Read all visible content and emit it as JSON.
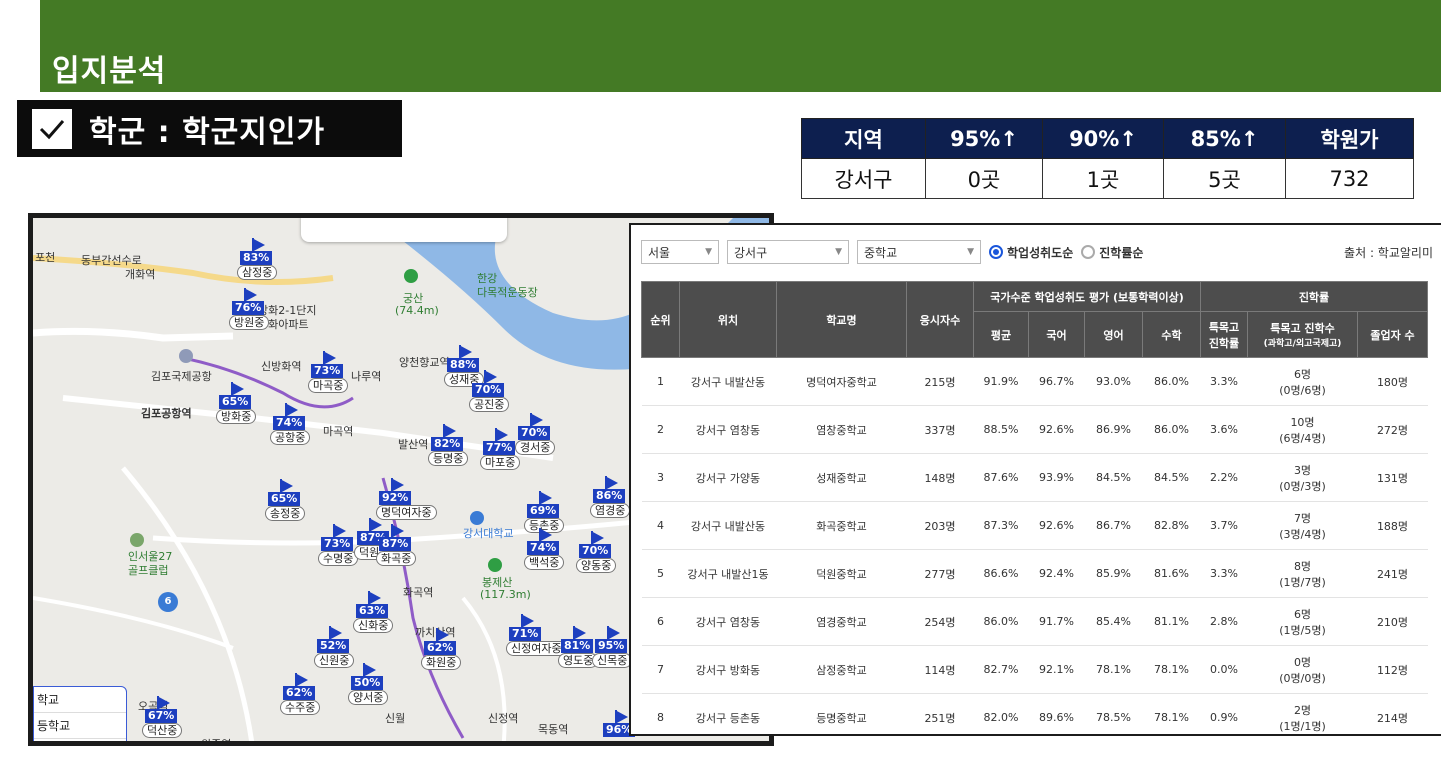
{
  "header": {
    "title": "입지분석"
  },
  "section": {
    "label": "학군 : 학군지인가"
  },
  "summary": {
    "headers": [
      "지역",
      "95%↑",
      "90%↑",
      "85%↑",
      "학원가"
    ],
    "values": [
      "강서구",
      "0곳",
      "1곳",
      "5곳",
      "732"
    ]
  },
  "map": {
    "labels": [
      "포천",
      "동부간선수로",
      "개화역",
      "방화2-1단지",
      "방화아파트",
      "궁산",
      "(74.4m)",
      "한강",
      "다목적운동장",
      "김포국제공항",
      "김포공항역",
      "신방화역",
      "양천향교역",
      "나루역",
      "마곡역",
      "발산역",
      "인서울27",
      "골프클럽",
      "강서대학교",
      "봉제산",
      "(117.3m)",
      "화곡역",
      "까치산역",
      "신월",
      "목동역",
      "원종역",
      "오곡역",
      "신정역"
    ],
    "pins": [
      {
        "pct": "83%",
        "name": "삼정중"
      },
      {
        "pct": "76%",
        "name": "방원중"
      },
      {
        "pct": "65%",
        "name": "방화중"
      },
      {
        "pct": "73%",
        "name": "마곡중"
      },
      {
        "pct": "74%",
        "name": "공항중"
      },
      {
        "pct": "88%",
        "name": "성재중"
      },
      {
        "pct": "70%",
        "name": "공진중"
      },
      {
        "pct": "82%",
        "name": "등명중"
      },
      {
        "pct": "77%",
        "name": "마포중"
      },
      {
        "pct": "70%",
        "name": "경서중"
      },
      {
        "pct": "65%",
        "name": "송정중"
      },
      {
        "pct": "92%",
        "name": "명덕여자중"
      },
      {
        "pct": "73%",
        "name": "수명중"
      },
      {
        "pct": "87%",
        "name": "덕원중"
      },
      {
        "pct": "87%",
        "name": "화곡중"
      },
      {
        "pct": "69%",
        "name": "등촌중"
      },
      {
        "pct": "74%",
        "name": "백석중"
      },
      {
        "pct": "86%",
        "name": "염경중"
      },
      {
        "pct": "70%",
        "name": "양동중"
      },
      {
        "pct": "63%",
        "name": "신화중"
      },
      {
        "pct": "52%",
        "name": "신원중"
      },
      {
        "pct": "62%",
        "name": "화원중"
      },
      {
        "pct": "71%",
        "name": "신정여자중"
      },
      {
        "pct": "81%",
        "name": "영도중"
      },
      {
        "pct": "95%",
        "name": "신목중"
      },
      {
        "pct": "50%",
        "name": "양서중"
      },
      {
        "pct": "62%",
        "name": "수주중"
      },
      {
        "pct": "67%",
        "name": "덕산중"
      },
      {
        "pct": "96%",
        "name": ""
      }
    ],
    "tabs": [
      "학교",
      "등학교"
    ],
    "route_badge": "6"
  },
  "table": {
    "filters": {
      "city": "서울",
      "district": "강서구",
      "level": "중학교",
      "radio_on": "학업성취도순",
      "radio_off": "진학률순",
      "source": "출처 : 학교알리미"
    },
    "head": {
      "rank": "순위",
      "location": "위치",
      "school": "학교명",
      "applicants": "응시자수",
      "group_national": "국가수준 학업성취도 평가 (보통학력이상)",
      "avg": "평균",
      "kor": "국어",
      "eng": "영어",
      "math": "수학",
      "group_adv": "진학률",
      "sp_rate": "특목고 진학률",
      "sp_count": "특목고 진학수",
      "sp_count_sub": "(과학고/외고국제고)",
      "graduates": "졸업자 수"
    },
    "rows": [
      {
        "rank": "1",
        "loc": "강서구 내발산동",
        "school": "명덕여자중학교",
        "app": "215명",
        "avg": "91.9%",
        "kor": "96.7%",
        "eng": "93.0%",
        "math": "86.0%",
        "sp": "3.3%",
        "cnt": "6명",
        "cnt_sub": "(0명/6명)",
        "grad": "180명"
      },
      {
        "rank": "2",
        "loc": "강서구 염창동",
        "school": "염창중학교",
        "app": "337명",
        "avg": "88.5%",
        "kor": "92.6%",
        "eng": "86.9%",
        "math": "86.0%",
        "sp": "3.6%",
        "cnt": "10명",
        "cnt_sub": "(6명/4명)",
        "grad": "272명"
      },
      {
        "rank": "3",
        "loc": "강서구 가양동",
        "school": "성재중학교",
        "app": "148명",
        "avg": "87.6%",
        "kor": "93.9%",
        "eng": "84.5%",
        "math": "84.5%",
        "sp": "2.2%",
        "cnt": "3명",
        "cnt_sub": "(0명/3명)",
        "grad": "131명"
      },
      {
        "rank": "4",
        "loc": "강서구 내발산동",
        "school": "화곡중학교",
        "app": "203명",
        "avg": "87.3%",
        "kor": "92.6%",
        "eng": "86.7%",
        "math": "82.8%",
        "sp": "3.7%",
        "cnt": "7명",
        "cnt_sub": "(3명/4명)",
        "grad": "188명"
      },
      {
        "rank": "5",
        "loc": "강서구 내발산1동",
        "school": "덕원중학교",
        "app": "277명",
        "avg": "86.6%",
        "kor": "92.4%",
        "eng": "85.9%",
        "math": "81.6%",
        "sp": "3.3%",
        "cnt": "8명",
        "cnt_sub": "(1명/7명)",
        "grad": "241명"
      },
      {
        "rank": "6",
        "loc": "강서구 염창동",
        "school": "염경중학교",
        "app": "254명",
        "avg": "86.0%",
        "kor": "91.7%",
        "eng": "85.4%",
        "math": "81.1%",
        "sp": "2.8%",
        "cnt": "6명",
        "cnt_sub": "(1명/5명)",
        "grad": "210명"
      },
      {
        "rank": "7",
        "loc": "강서구 방화동",
        "school": "삼정중학교",
        "app": "114명",
        "avg": "82.7%",
        "kor": "92.1%",
        "eng": "78.1%",
        "math": "78.1%",
        "sp": "0.0%",
        "cnt": "0명",
        "cnt_sub": "(0명/0명)",
        "grad": "112명"
      },
      {
        "rank": "8",
        "loc": "강서구 등촌동",
        "school": "등명중학교",
        "app": "251명",
        "avg": "82.0%",
        "kor": "89.6%",
        "eng": "78.5%",
        "math": "78.1%",
        "sp": "0.9%",
        "cnt": "2명",
        "cnt_sub": "(1명/1명)",
        "grad": "214명"
      }
    ]
  },
  "colors": {
    "header_green": "#447a25",
    "navy": "#0d1f4f",
    "pin_blue": "#1d3fbf",
    "river": "#8fb8e6"
  }
}
